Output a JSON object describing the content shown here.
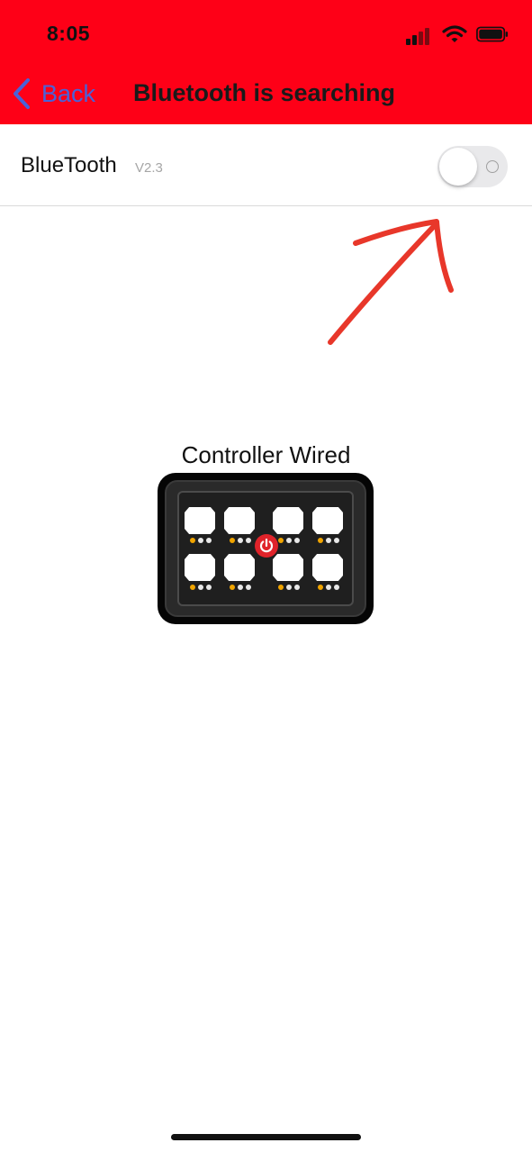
{
  "status_bar": {
    "time": "8:05",
    "icons": [
      "signal-icon",
      "wifi-icon",
      "battery-icon"
    ]
  },
  "nav": {
    "back_label": "Back",
    "title": "Bluetooth is searching",
    "back_icon": "chevron-left-icon"
  },
  "bluetooth": {
    "label": "BlueTooth",
    "version": "V2.3",
    "toggle_on": false
  },
  "controller": {
    "caption": "Controller Wired",
    "button_count": 8,
    "power_icon": "power-icon"
  },
  "colors": {
    "header_bg": "#fe0017",
    "back_link": "#4a62d8",
    "annotation": "#e8372a",
    "indicator_amber": "#f0a400",
    "power_red": "#e0232a"
  }
}
